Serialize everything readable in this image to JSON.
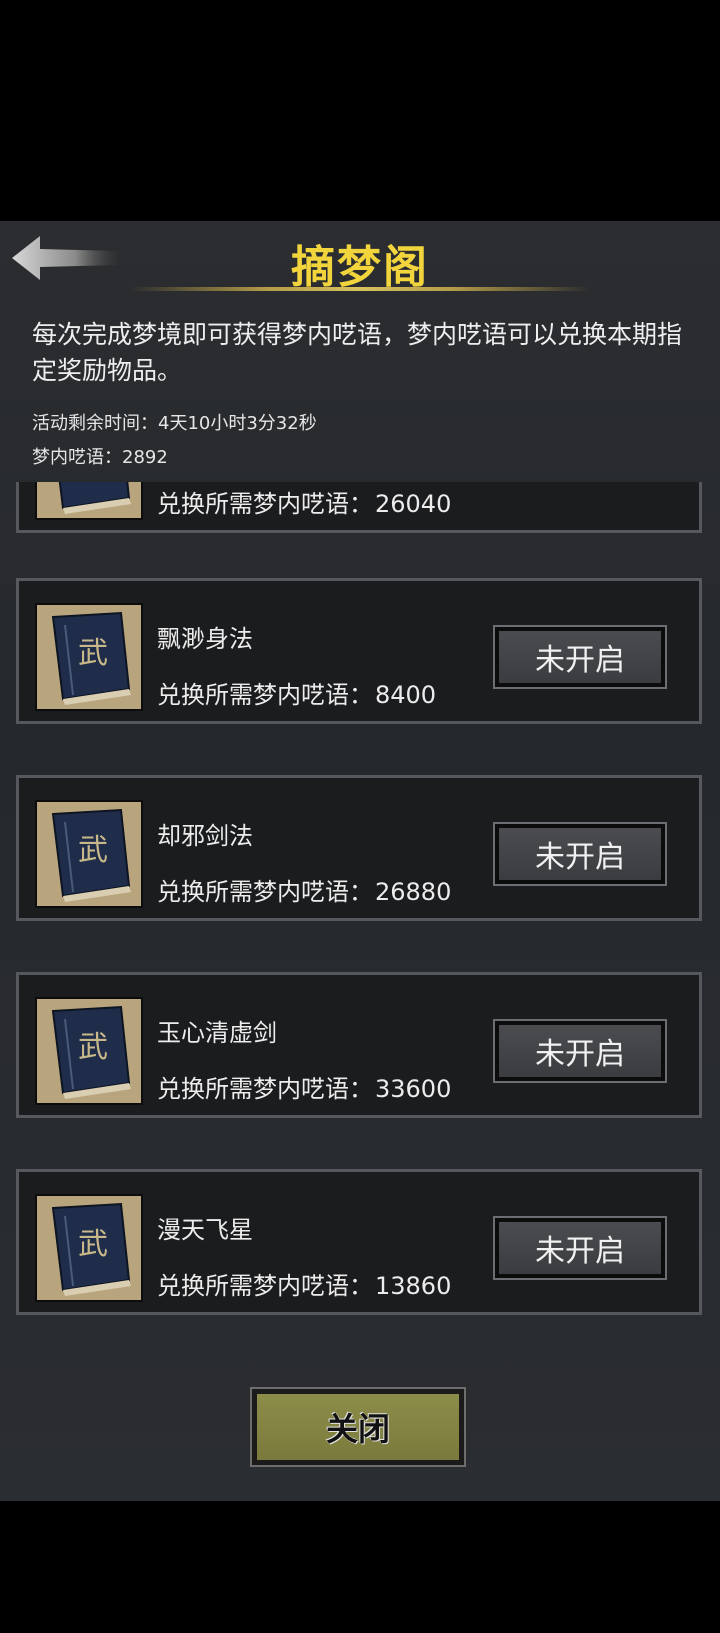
{
  "colors": {
    "title": "#f2d43c",
    "panel_bg": "#2a2d30",
    "close_button": "#85853f"
  },
  "header": {
    "title": "摘梦阁",
    "back_icon": "back-arrow-icon"
  },
  "description": "每次完成梦境即可获得梦内呓语，梦内呓语可以兑换本期指定奖励物品。",
  "time_left": {
    "label": "活动剩余时间：",
    "value": "4天10小时3分32秒"
  },
  "currency": {
    "label": "梦内呓语：",
    "value": "2892"
  },
  "items": [
    {
      "name": "",
      "cost_label": "兑换所需梦内呓语：",
      "cost": "26040",
      "button": ""
    },
    {
      "name": "飘渺身法",
      "cost_label": "兑换所需梦内呓语：",
      "cost": "8400",
      "button": "未开启"
    },
    {
      "name": "却邪剑法",
      "cost_label": "兑换所需梦内呓语：",
      "cost": "26880",
      "button": "未开启"
    },
    {
      "name": "玉心清虚剑",
      "cost_label": "兑换所需梦内呓语：",
      "cost": "33600",
      "button": "未开启"
    },
    {
      "name": "漫天飞星",
      "cost_label": "兑换所需梦内呓语：",
      "cost": "13860",
      "button": "未开启"
    }
  ],
  "book_glyph": "武",
  "close_label": "关闭"
}
